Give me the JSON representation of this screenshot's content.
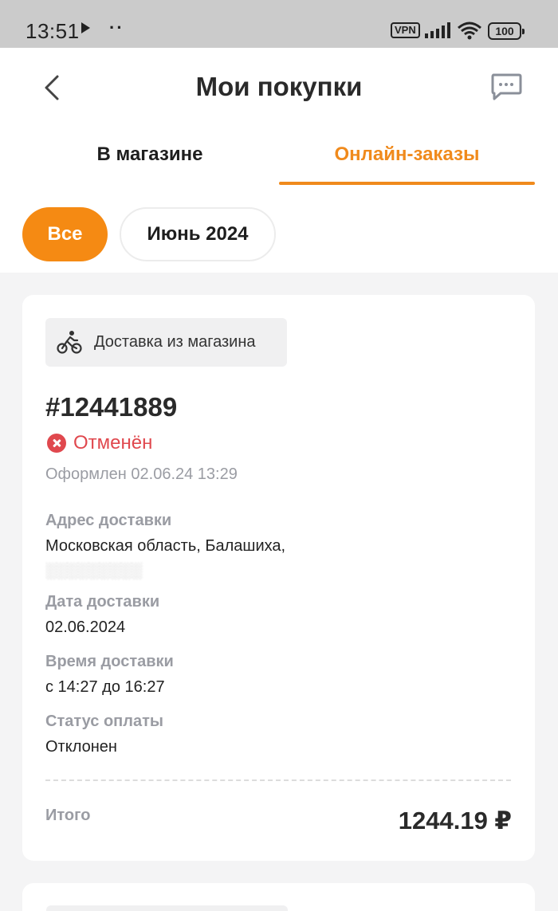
{
  "status_bar": {
    "time": "13:51",
    "dots": "··",
    "vpn": "VPN",
    "battery": "100"
  },
  "header": {
    "title": "Мои покупки"
  },
  "tabs": [
    {
      "label": "В магазине",
      "active": false
    },
    {
      "label": "Онлайн-заказы",
      "active": true
    }
  ],
  "filters": {
    "all": "Все",
    "month": "Июнь 2024"
  },
  "order": {
    "delivery_type": "Доставка из магазина",
    "number": "#12441889",
    "status": "Отменён",
    "created": "Оформлен 02.06.24 13:29",
    "address_label": "Адрес доставки",
    "address_value": "Московская область, Балашиха,",
    "delivery_date_label": "Дата доставки",
    "delivery_date_value": "02.06.2024",
    "delivery_time_label": "Время доставки",
    "delivery_time_value": "с 14:27 до 16:27",
    "payment_status_label": "Статус оплаты",
    "payment_status_value": "Отклонен",
    "total_label": "Итого",
    "total_value": "1244.19 ₽"
  },
  "colors": {
    "accent": "#f58a13",
    "status_cancelled": "#e0484e",
    "muted_text": "#9a9ca3"
  }
}
